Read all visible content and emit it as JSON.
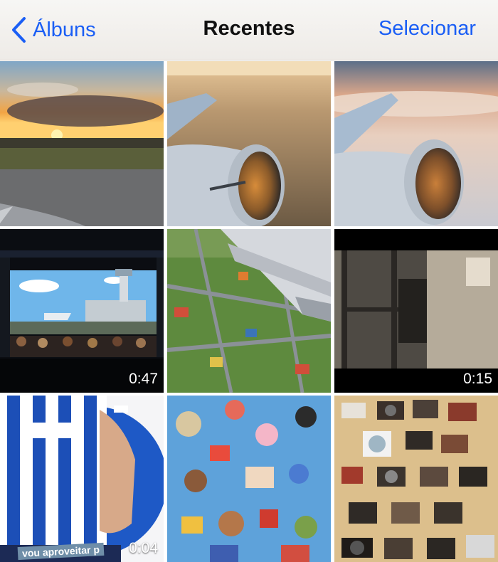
{
  "navbar": {
    "back_label": "Álbuns",
    "title": "Recentes",
    "select_label": "Selecionar"
  },
  "accent_color": "#1a5ef5",
  "photos": [
    {
      "kind": "photo",
      "subject": "sunset over runway"
    },
    {
      "kind": "photo",
      "subject": "airplane engine over land"
    },
    {
      "kind": "photo",
      "subject": "airplane engine above clouds"
    },
    {
      "kind": "video",
      "subject": "cartoon airport scene in cinema",
      "duration": "0:47"
    },
    {
      "kind": "photo",
      "subject": "airplane wing over play mat"
    },
    {
      "kind": "video",
      "subject": "dark room doorway",
      "duration": "0:15"
    },
    {
      "kind": "video",
      "subject": "striped football jersey",
      "duration": "0:04",
      "caption": "vou aproveitar p"
    },
    {
      "kind": "photo",
      "subject": "toys on blue floor"
    },
    {
      "kind": "photo",
      "subject": "vintage cameras collection"
    }
  ]
}
